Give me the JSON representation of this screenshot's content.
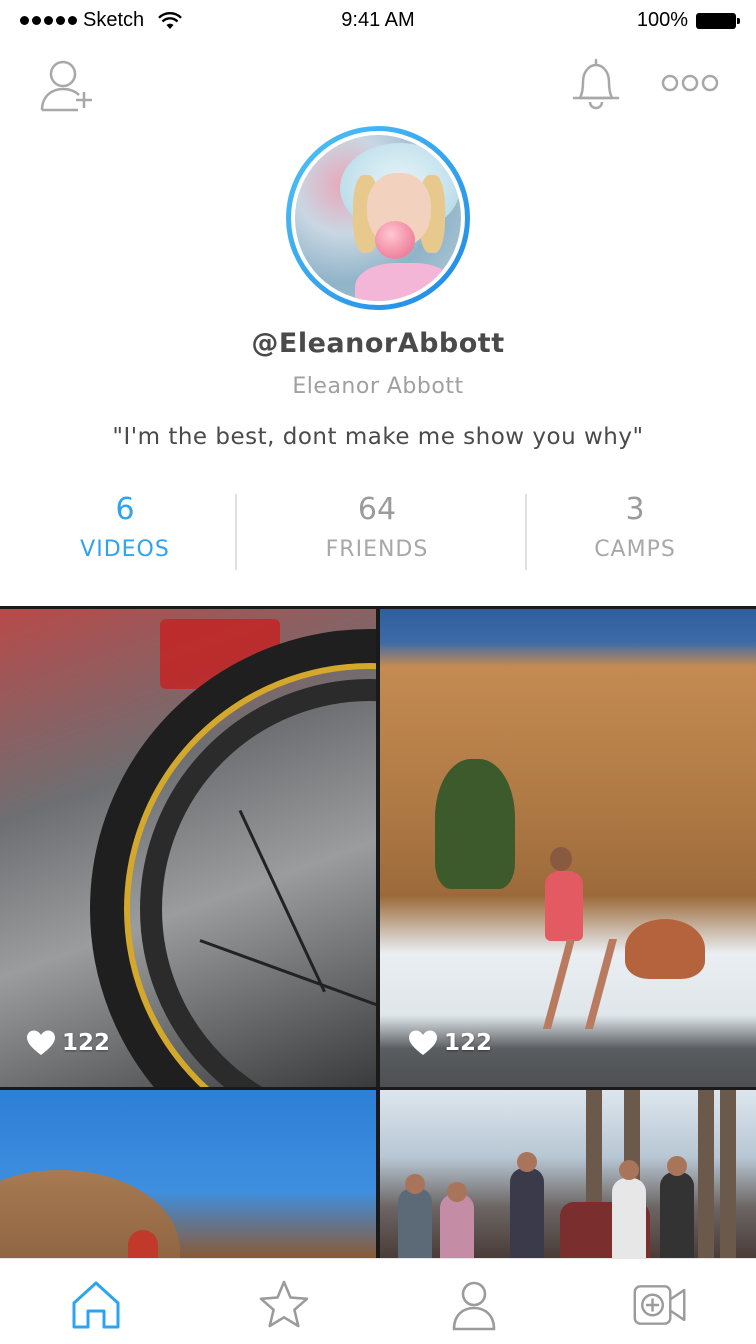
{
  "status_bar": {
    "carrier": "Sketch",
    "time": "9:41 AM",
    "battery": "100%"
  },
  "top_icons": [
    "add-user-icon",
    "bell-icon",
    "more-icon"
  ],
  "profile": {
    "username": "@EleanorAbbott",
    "full_name": "Eleanor Abbott",
    "bio": "\"I'm the best, dont make me show you why\""
  },
  "stats": [
    {
      "count": "6",
      "label": "VIDEOS",
      "active": true
    },
    {
      "count": "64",
      "label": "FRIENDS",
      "active": false
    },
    {
      "count": "3",
      "label": "CAMPS",
      "active": false
    }
  ],
  "videos": [
    {
      "likes": "122",
      "subject": "bicycle wheel"
    },
    {
      "likes": "122",
      "subject": "runner by cliff"
    },
    {
      "likes": "",
      "subject": "rock dome"
    },
    {
      "likes": "",
      "subject": "crowd at beach"
    }
  ],
  "tab_bar": {
    "items": [
      "home-icon",
      "star-icon",
      "profile-icon",
      "video-add-icon"
    ],
    "active": "home-icon"
  },
  "colors": {
    "accent": "#2ea3f2",
    "muted": "#a8a8a8",
    "icon_gray": "#9b9b9b"
  }
}
